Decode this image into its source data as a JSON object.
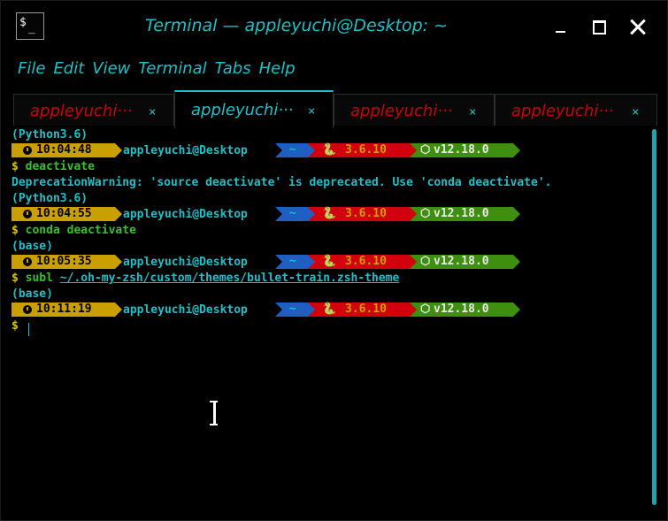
{
  "window": {
    "title": "Terminal — appleyuchi@Desktop: ~",
    "app_icon_text_1": "$",
    "app_icon_text_2": "_"
  },
  "menu": [
    "File",
    "Edit",
    "View",
    "Terminal",
    "Tabs",
    "Help"
  ],
  "tabs": [
    {
      "label": "appleyuchi···",
      "close": "×",
      "active": false
    },
    {
      "label": "appleyuchi···",
      "close": "×",
      "active": true
    },
    {
      "label": "appleyuchi···",
      "close": "×",
      "active": false
    },
    {
      "label": "appleyuchi···",
      "close": "×",
      "active": false
    }
  ],
  "prompt": {
    "user": "appleyuchi@Desktop",
    "dir": "~",
    "python_icon": "🐍",
    "python_version": "3.6.10",
    "node_icon": "⬡",
    "node_version": "v12.18.0"
  },
  "lines": {
    "env1": "(Python3.6)",
    "time1": "10:04:48",
    "cmd1_dollar": "$",
    "cmd1": "deactivate",
    "warning": "DeprecationWarning: 'source deactivate' is deprecated. Use 'conda deactivate'.",
    "env2": "(Python3.6)",
    "time2": "10:04:55",
    "cmd2_dollar": "$",
    "cmd2": "conda",
    "cmd2_arg": "deactivate",
    "env3": "(base)",
    "time3": "10:05:35",
    "cmd3_dollar": "$",
    "cmd3": "subl",
    "cmd3_arg": "~/.oh-my-zsh/custom/themes/bullet-train.zsh-theme",
    "env4": "(base)",
    "time4": "10:11:19",
    "cmd4_dollar": "$"
  }
}
